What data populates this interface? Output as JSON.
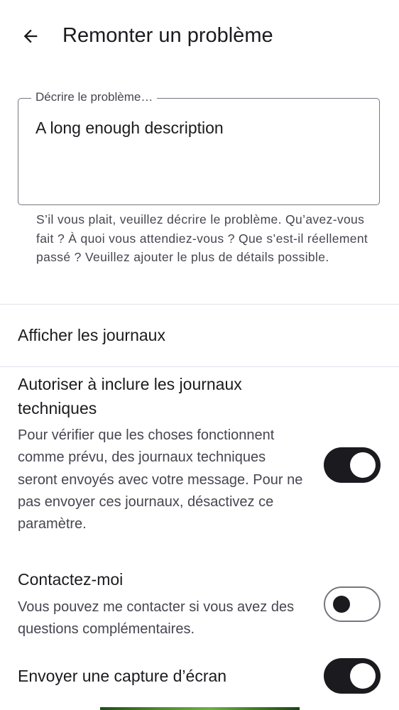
{
  "header": {
    "title": "Remonter un problème",
    "back_icon": "arrow-left-icon"
  },
  "description_field": {
    "label": "Décrire le problème…",
    "value": "A long enough description",
    "helper": "S’il vous plait, veuillez décrire le problème. Qu’avez-vous fait ? À quoi vous attendiez-vous ? Que s’est-il réellement passé ? Veuillez ajouter le plus de détails possible."
  },
  "view_logs": {
    "label": "Afficher les journaux"
  },
  "settings": {
    "include_logs": {
      "title": "Autoriser à inclure les journaux techniques",
      "description": "Pour vérifier que les choses fonctionnent comme prévu, des journaux techniques seront envoyés avec votre message. Pour ne pas envoyer ces journaux, désactivez ce paramètre.",
      "enabled": true
    },
    "contact_me": {
      "title": "Contactez-moi",
      "description": "Vous pouvez me contacter si vous avez des questions complémentaires.",
      "enabled": false
    },
    "send_screenshot": {
      "title": "Envoyer une capture d’écran",
      "enabled": true
    }
  },
  "colors": {
    "text_primary": "#1b1b1f",
    "text_secondary": "#45464f",
    "outline": "#75777f",
    "divider": "#e1e2ea",
    "toggle_on": "#1b1b1f"
  }
}
